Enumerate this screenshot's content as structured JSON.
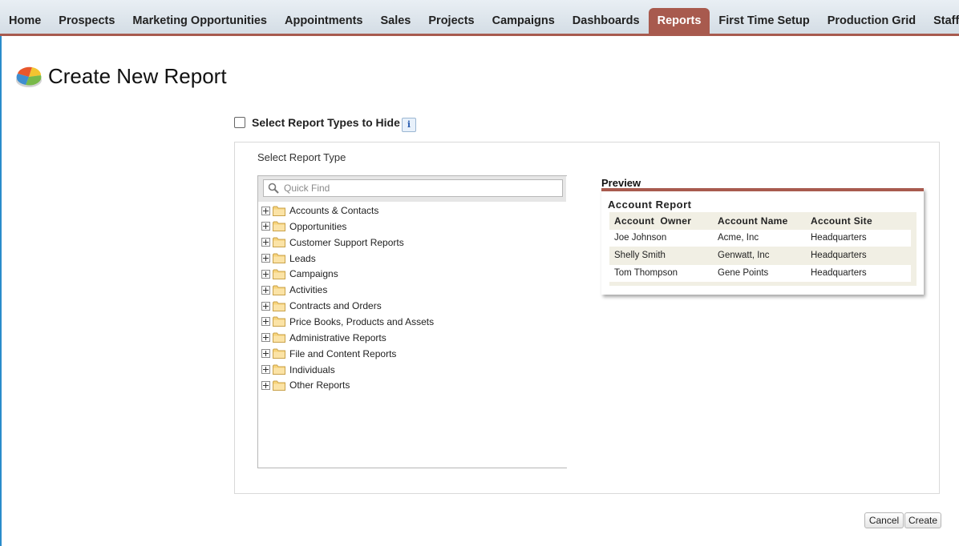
{
  "nav": {
    "tabs": [
      {
        "label": "Home"
      },
      {
        "label": "Prospects"
      },
      {
        "label": "Marketing Opportunities"
      },
      {
        "label": "Appointments"
      },
      {
        "label": "Sales"
      },
      {
        "label": "Projects"
      },
      {
        "label": "Campaigns"
      },
      {
        "label": "Dashboards"
      },
      {
        "label": "Reports",
        "active": true
      },
      {
        "label": "First Time Setup"
      },
      {
        "label": "Production Grid"
      },
      {
        "label": "Staff C"
      }
    ]
  },
  "page": {
    "title": "Create New Report",
    "icon": "reports-pie-icon"
  },
  "hide_types": {
    "label": "Select Report Types to Hide",
    "checked": false,
    "info_icon": "i"
  },
  "selector": {
    "label": "Select Report Type",
    "search_placeholder": "Quick Find",
    "folders": [
      "Accounts & Contacts",
      "Opportunities",
      "Customer Support Reports",
      "Leads",
      "Campaigns",
      "Activities",
      "Contracts and Orders",
      "Price Books, Products and Assets",
      "Administrative Reports",
      "File and Content Reports",
      "Individuals",
      "Other Reports"
    ]
  },
  "preview": {
    "label": "Preview",
    "report_title": "Account Report",
    "columns": [
      "Account  Owner",
      "Account Name",
      "Account Site"
    ],
    "rows": [
      [
        "Joe Johnson",
        "Acme, Inc",
        "Headquarters"
      ],
      [
        "Shelly Smith",
        "Genwatt, Inc",
        "Headquarters"
      ],
      [
        "Tom Thompson",
        "Gene Points",
        "Headquarters"
      ]
    ]
  },
  "buttons": {
    "cancel": "Cancel",
    "create": "Create"
  },
  "colors": {
    "accent": "#a85a4e",
    "nav_bg": "#dde5ec",
    "preview_table_bg": "#f1efe4"
  }
}
